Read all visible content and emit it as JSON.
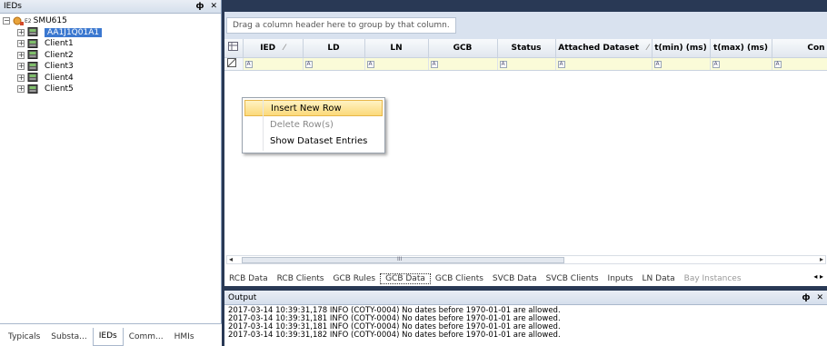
{
  "left_panel": {
    "title": "IEDs",
    "pin_glyph": "ф",
    "close_glyph": "✕",
    "root": {
      "label": "SMU615",
      "badge": "E2"
    },
    "items": [
      {
        "label": "AA1J1Q01A1",
        "selected": true
      },
      {
        "label": "Client1"
      },
      {
        "label": "Client2"
      },
      {
        "label": "Client3"
      },
      {
        "label": "Client4"
      },
      {
        "label": "Client5"
      }
    ],
    "bottom_tabs": [
      "Typicals",
      "Substa...",
      "IEDs",
      "Comm...",
      "HMIs"
    ],
    "active_bottom_tab": "IEDs"
  },
  "grid": {
    "group_hint": "Drag a column header here to group by that column.",
    "columns": [
      "IED",
      "LD",
      "LN",
      "GCB",
      "Status",
      "Attached Dataset",
      "t(min) (ms)",
      "t(max) (ms)",
      "Con"
    ]
  },
  "context_menu": {
    "items": [
      {
        "label": "Insert New Row",
        "state": "highlighted"
      },
      {
        "label": "Delete Row(s)",
        "state": "disabled"
      },
      {
        "label": "Show Dataset Entries",
        "state": "normal"
      }
    ]
  },
  "data_tabs": [
    "RCB Data",
    "RCB Clients",
    "GCB Rules",
    "GCB Data",
    "GCB Clients",
    "SVCB Data",
    "SVCB Clients",
    "Inputs",
    "LN Data",
    "Bay Instances"
  ],
  "active_data_tab": "GCB Data",
  "scroll_mark": "III",
  "output": {
    "title": "Output",
    "lines": [
      "2017-03-14 10:39:31,178 INFO  (COTY-0004) No dates before 1970-01-01 are allowed.",
      "2017-03-14 10:39:31,181 INFO  (COTY-0004) No dates before 1970-01-01 are allowed.",
      "2017-03-14 10:39:31,181 INFO  (COTY-0004) No dates before 1970-01-01 are allowed.",
      "2017-03-14 10:39:31,182 INFO  (COTY-0004) No dates before 1970-01-01 are allowed."
    ]
  },
  "colors": {
    "selection": "#3b78d0",
    "frame": "#293955",
    "filter_row": "#fafbd8"
  }
}
